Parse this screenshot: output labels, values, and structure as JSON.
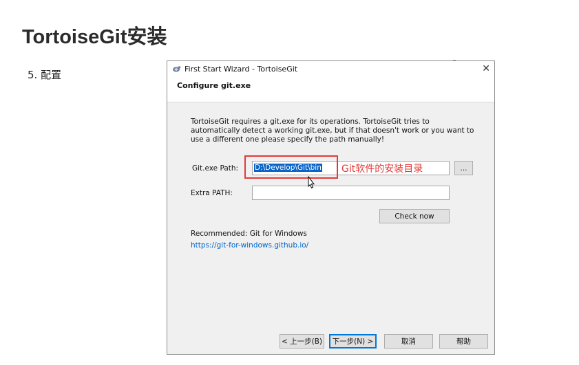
{
  "slide": {
    "title": "TortoiseGit安装",
    "step": "5. 配置"
  },
  "dialog": {
    "window_title": "First Start Wizard - TortoiseGit",
    "close_glyph": "✕",
    "page_heading": "Configure git.exe",
    "description": "TortoiseGit requires a git.exe for its operations. TortoiseGit tries to automatically detect a working git.exe, but if that doesn't work or you want to use a different one please specify the path manually!",
    "gitexe_label": "Git.exe Path:",
    "gitexe_value": "D:\\Develop\\Git\\bin",
    "browse_label": "...",
    "extra_path_label": "Extra PATH:",
    "extra_path_value": "",
    "check_now_label": "Check now",
    "recommended_text": "Recommended: Git for Windows",
    "recommended_link": "https://git-for-windows.github.io/",
    "buttons": {
      "back": "< 上一步(B)",
      "next": "下一步(N) >",
      "cancel": "取消",
      "help": "帮助"
    }
  },
  "annotation": {
    "text": "Git软件的安装目录",
    "color": "#e53935"
  },
  "icons": {
    "title_icon": "tortoisegit-icon",
    "cursor": "mouse-cursor-icon"
  }
}
